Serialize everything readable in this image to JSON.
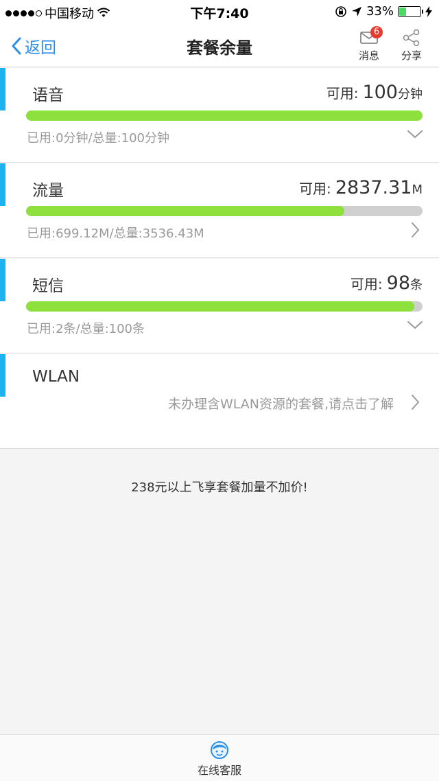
{
  "status_bar": {
    "carrier": "中国移动",
    "time": "下午7:40",
    "battery_text": "33%",
    "battery_level": 0.33
  },
  "nav": {
    "back_label": "返回",
    "title": "套餐余量",
    "messages_label": "消息",
    "messages_badge": "6",
    "share_label": "分享"
  },
  "packages": [
    {
      "name": "语音",
      "available_label": "可用:",
      "available_value": "100",
      "available_unit": "分钟",
      "used_text": "已用:0分钟/总量:100分钟",
      "remaining_fraction": 1.0
    },
    {
      "name": "流量",
      "available_label": "可用:",
      "available_value": "2837.31",
      "available_unit": "M",
      "used_text": "已用:699.12M/总量:3536.43M",
      "remaining_fraction": 0.802
    },
    {
      "name": "短信",
      "available_label": "可用:",
      "available_value": "98",
      "available_unit": "条",
      "used_text": "已用:2条/总量:100条",
      "remaining_fraction": 0.98
    },
    {
      "name": "WLAN",
      "description": "未办理含WLAN资源的套餐,请点击了解"
    }
  ],
  "promo_text": "238元以上飞享套餐加量不加价!",
  "bottom": {
    "service_label": "在线客服"
  },
  "colors": {
    "accent": "#1fb2f0",
    "bar_fill": "#8ee03c",
    "bar_track": "#cfcfcf",
    "link": "#2a8ee8",
    "badge": "#e63b2e"
  }
}
